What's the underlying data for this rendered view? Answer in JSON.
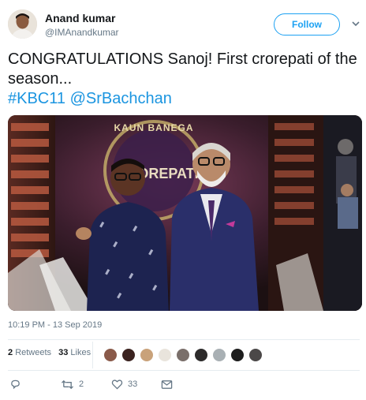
{
  "user": {
    "name": "Anand kumar",
    "handle": "@IMAnandkumar"
  },
  "follow_label": "Follow",
  "tweet": {
    "text": "CONGRATULATIONS Sanoj! First crorepati of the season...",
    "hashtag": "#KBC11",
    "mention": "@SrBachchan"
  },
  "photo": {
    "logo_top": "KAUN BANEGA",
    "logo_mid": "CROREPATI"
  },
  "timestamp": "10:19 PM - 13 Sep 2019",
  "stats": {
    "retweets_count": "2",
    "retweets_label": "Retweets",
    "likes_count": "33",
    "likes_label": "Likes"
  },
  "likers": [
    "#8a5a4a",
    "#3b2320",
    "#c9a27a",
    "#e9e4dc",
    "#7a6f6a",
    "#2d2b2b",
    "#a9b0b4",
    "#1e1e1e",
    "#4b4848"
  ],
  "actions": {
    "reply_icon": "reply-icon",
    "retweet_icon": "retweet-icon",
    "retweet_count": "2",
    "like_icon": "heart-icon",
    "like_count": "33",
    "dm_icon": "envelope-icon"
  },
  "colors": {
    "accent": "#1da1f2",
    "link": "#1b95e0",
    "muted": "#657786"
  }
}
